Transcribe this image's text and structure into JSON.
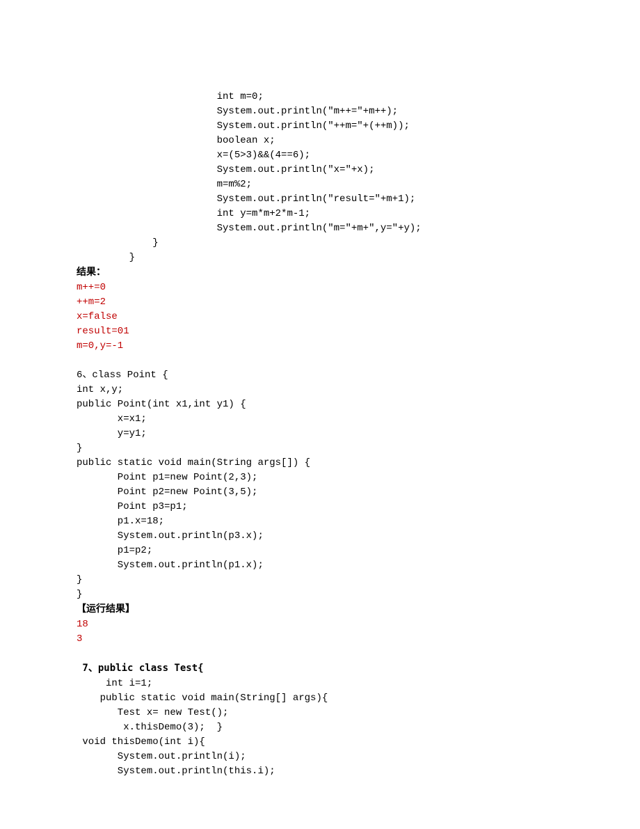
{
  "block1_code": "                        int m=0;\n                        System.out.println(\"m++=\"+m++);\n                        System.out.println(\"++m=\"+(++m));\n                        boolean x;\n                        x=(5>3)&&(4==6);\n                        System.out.println(\"x=\"+x);\n                        m=m%2;\n                        System.out.println(\"result=\"+m+1);\n                        int y=m*m+2*m-1;\n                        System.out.println(\"m=\"+m+\",y=\"+y);\n             }\n         }",
  "block1_result_label": "结果：",
  "block1_result": "m++=0\n++m=2\nx=false\nresult=01\nm=0,y=-1",
  "block2_code": "6、class Point {\nint x,y;\npublic Point(int x1,int y1) {\n       x=x1;\n       y=y1;\n}\npublic static void main(String args[]) {\n       Point p1=new Point(2,3);\n       Point p2=new Point(3,5);\n       Point p3=p1;\n       p1.x=18;\n       System.out.println(p3.x);\n       p1=p2;\n       System.out.println(p1.x);\n}\n}",
  "block2_result_label": "【运行结果】",
  "block2_result": "18\n3",
  "block3_code": " 7、public class Test{\n     int i=1;\n    public static void main(String[] args){\n       Test x= new Test();\n        x.thisDemo(3);  }\n void thisDemo(int i){\n       System.out.println(i);\n       System.out.println(this.i);"
}
